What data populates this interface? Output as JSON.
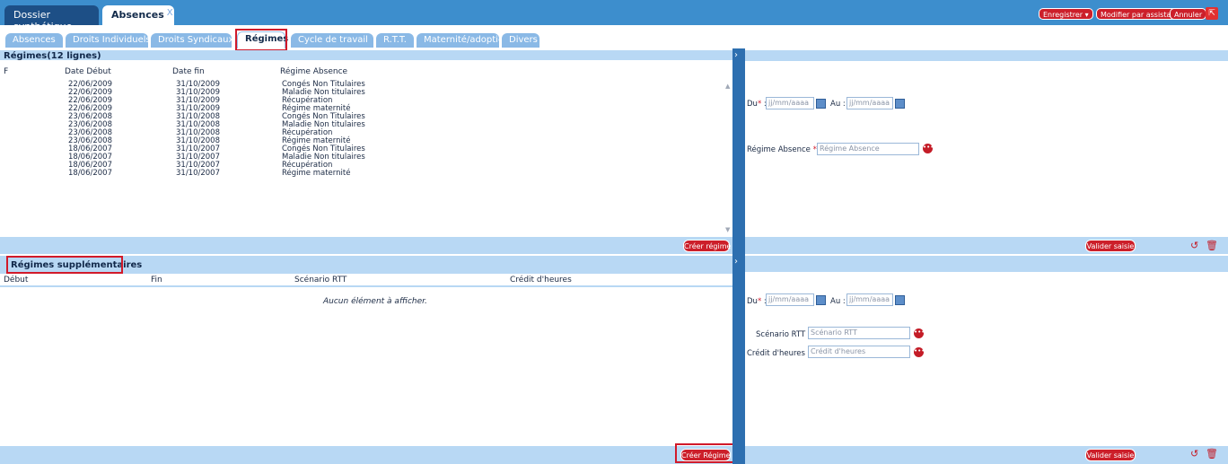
{
  "header": {
    "doc_tabs": [
      {
        "label": "Dossier synthétique"
      },
      {
        "label": "Absences",
        "close": "X"
      }
    ],
    "buttons": {
      "save": "Enregistrer",
      "assistant": "Modifier par assistant",
      "cancel": "Annuler"
    }
  },
  "sub_tabs": [
    "Absences",
    "Droits Individuels",
    "Droits Syndicaux",
    "Régimes",
    "Cycle de travail",
    "R.T.T.",
    "Maternité/adoption",
    "Divers"
  ],
  "regimes": {
    "title": "Régimes(12 lignes)",
    "columns": [
      "F",
      "Date Début",
      "Date fin",
      "Régime Absence"
    ],
    "rows": [
      [
        "22/06/2009",
        "31/10/2009",
        "Congés Non Titulaires"
      ],
      [
        "22/06/2009",
        "31/10/2009",
        "Maladie Non titulaires"
      ],
      [
        "22/06/2009",
        "31/10/2009",
        "Récupération"
      ],
      [
        "22/06/2009",
        "31/10/2009",
        "Régime maternité"
      ],
      [
        "23/06/2008",
        "31/10/2008",
        "Congés Non Titulaires"
      ],
      [
        "23/06/2008",
        "31/10/2008",
        "Maladie Non titulaires"
      ],
      [
        "23/06/2008",
        "31/10/2008",
        "Récupération"
      ],
      [
        "23/06/2008",
        "31/10/2008",
        "Régime maternité"
      ],
      [
        "18/06/2007",
        "31/10/2007",
        "Congés Non Titulaires"
      ],
      [
        "18/06/2007",
        "31/10/2007",
        "Maladie Non titulaires"
      ],
      [
        "18/06/2007",
        "31/10/2007",
        "Récupération"
      ],
      [
        "18/06/2007",
        "31/10/2007",
        "Régime maternité"
      ]
    ],
    "create_button": "Créer régime"
  },
  "supplementaires": {
    "title": "Régimes supplémentaires",
    "columns": [
      "Début",
      "Fin",
      "Scénario RTT",
      "Crédit d'heures"
    ],
    "empty_text": "Aucun élément à afficher.",
    "create_button": "Créer Régime"
  },
  "form_top": {
    "du_label": "Du",
    "du_placeholder": "jj/mm/aaaa",
    "au_label": "Au :",
    "au_placeholder": "jj/mm/aaaa",
    "regime_label": "Régime Absence",
    "regime_placeholder": "Régime Absence",
    "validate": "Valider saisie"
  },
  "form_bottom": {
    "du_label": "Du",
    "du_placeholder": "jj/mm/aaaa",
    "au_label": "Au :",
    "au_placeholder": "jj/mm/aaaa",
    "rtt_label": "Scénario RTT :",
    "rtt_placeholder": "Scénario RTT",
    "credit_label": "Crédit d'heures :",
    "credit_placeholder": "Crédit d'heures",
    "validate": "Valider saisie"
  },
  "colors": {
    "header_blue": "#3d8ecd",
    "accent_red": "#cc1f2a",
    "panel_blue": "#b8d8f4"
  }
}
